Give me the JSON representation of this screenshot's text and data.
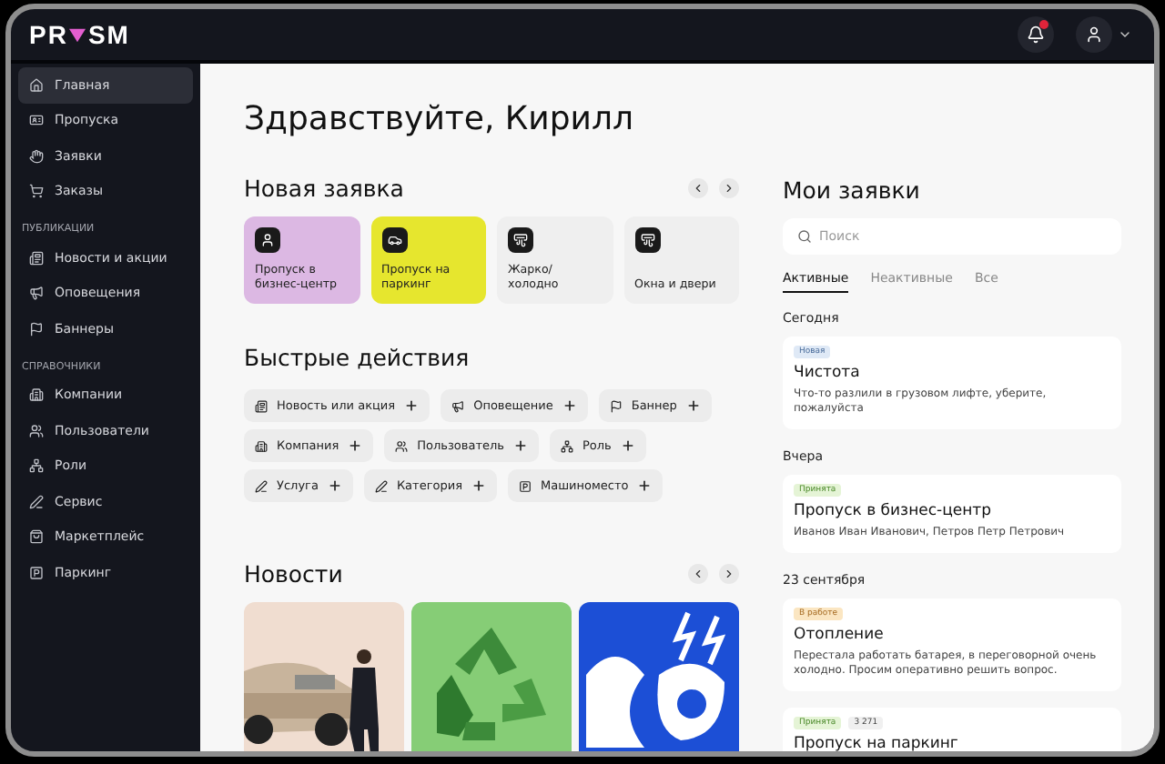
{
  "header": {
    "logo": {
      "left": "PR",
      "right": "SM"
    },
    "notifications_unread": true
  },
  "sidebar": [
    {
      "kind": "item",
      "label": "Главная",
      "selected": true
    },
    {
      "kind": "item",
      "label": "Пропуска",
      "selected": false
    },
    {
      "kind": "item",
      "label": "Заявки",
      "selected": false
    },
    {
      "kind": "item",
      "label": "Заказы",
      "selected": false
    },
    {
      "kind": "section",
      "label": "ПУБЛИКАЦИИ"
    },
    {
      "kind": "item",
      "label": "Новости и акции",
      "selected": false
    },
    {
      "kind": "item",
      "label": "Оповещения",
      "selected": false
    },
    {
      "kind": "item",
      "label": "Баннеры",
      "selected": false
    },
    {
      "kind": "section",
      "label": "СПРАВОЧНИКИ"
    },
    {
      "kind": "item",
      "label": "Компании",
      "selected": false
    },
    {
      "kind": "item",
      "label": "Пользователи",
      "selected": false
    },
    {
      "kind": "item",
      "label": "Роли",
      "selected": false
    },
    {
      "kind": "item",
      "label": "Сервис",
      "selected": false
    },
    {
      "kind": "item",
      "label": "Маркетплейс",
      "selected": false
    },
    {
      "kind": "item",
      "label": "Паркинг",
      "selected": false
    }
  ],
  "greeting": "Здравствуйте, Кирилл",
  "new_request": {
    "title": "Новая заявка",
    "cards": [
      {
        "label": "Пропуск в бизнес-центр",
        "color": "#dcb8e3"
      },
      {
        "label": "Пропуск на паркинг",
        "color": "#e6e62e"
      },
      {
        "label": "Жарко/ холодно",
        "color": "#efefef"
      },
      {
        "label": "Окна и двери",
        "color": "#efefef"
      }
    ]
  },
  "quick_actions": {
    "title": "Быстрые действия",
    "rows": [
      [
        "Новость или акция",
        "Оповещение",
        "Баннер"
      ],
      [
        "Компания",
        "Пользователь",
        "Роль"
      ],
      [
        "Услуга",
        "Категория",
        "Машиноместо"
      ]
    ]
  },
  "news": {
    "title": "Новости"
  },
  "my_requests": {
    "title": "Мои заявки",
    "search": {
      "placeholder": "Поиск"
    },
    "tabs": [
      {
        "label": "Активные",
        "selected": true
      },
      {
        "label": "Неактивные",
        "selected": false
      },
      {
        "label": "Все",
        "selected": false
      }
    ],
    "groups": [
      {
        "date": "Сегодня",
        "items": [
          {
            "badges": [
              {
                "text": "Новая",
                "kind": "new"
              }
            ],
            "title": "Чистота",
            "text": "Что-то разлили в грузовом лифте, уберите, пожалуйста"
          }
        ]
      },
      {
        "date": "Вчера",
        "items": [
          {
            "badges": [
              {
                "text": "Принята",
                "kind": "accepted"
              }
            ],
            "title": "Пропуск в бизнес-центр",
            "text": "Иванов Иван Иванович, Петров Петр Петрович"
          }
        ]
      },
      {
        "date": "23 сентября",
        "items": [
          {
            "badges": [
              {
                "text": "В работе",
                "kind": "progress"
              }
            ],
            "title": "Отопление",
            "text": "Перестала работать батарея, в переговорной очень холодно. Просим оперативно решить вопрос."
          },
          {
            "badges": [
              {
                "text": "Принята",
                "kind": "accepted"
              },
              {
                "text": "3 271",
                "kind": "number"
              }
            ],
            "title": "Пропуск на паркинг"
          }
        ]
      }
    ]
  }
}
